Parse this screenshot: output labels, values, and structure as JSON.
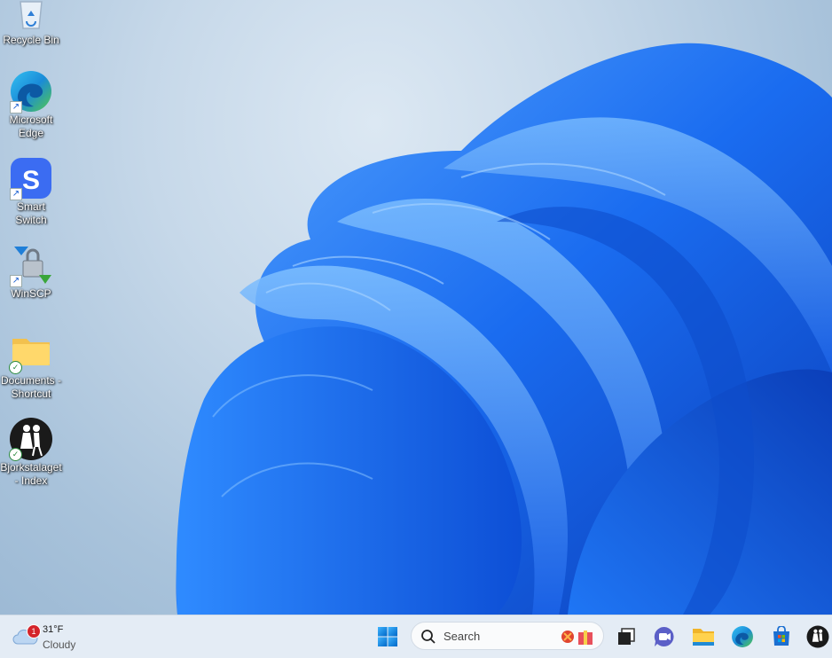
{
  "desktop": {
    "icons": [
      {
        "label": "Recycle Bin",
        "icon": "recycle-bin-icon"
      },
      {
        "label": "Microsoft\nEdge",
        "icon": "edge-icon"
      },
      {
        "label": "Smart Switch",
        "icon": "smart-switch-icon"
      },
      {
        "label": "WinSCP",
        "icon": "winscp-icon"
      },
      {
        "label": "Documents -\nShortcut",
        "icon": "folder-icon"
      },
      {
        "label": "Bjorkstalaget\n- Index",
        "icon": "dancers-icon"
      }
    ]
  },
  "taskbar": {
    "weather": {
      "temperature": "31°F",
      "condition": "Cloudy",
      "badge": "1"
    },
    "search": {
      "placeholder": "Search"
    },
    "apps": [
      "start-button",
      "task-view",
      "teams-chat",
      "file-explorer",
      "edge",
      "microsoft-store",
      "bjorkstalaget"
    ]
  },
  "colors": {
    "taskbar": "#e4ecf5",
    "bloom": "#1a6cf0",
    "accent": "#0078d4"
  }
}
